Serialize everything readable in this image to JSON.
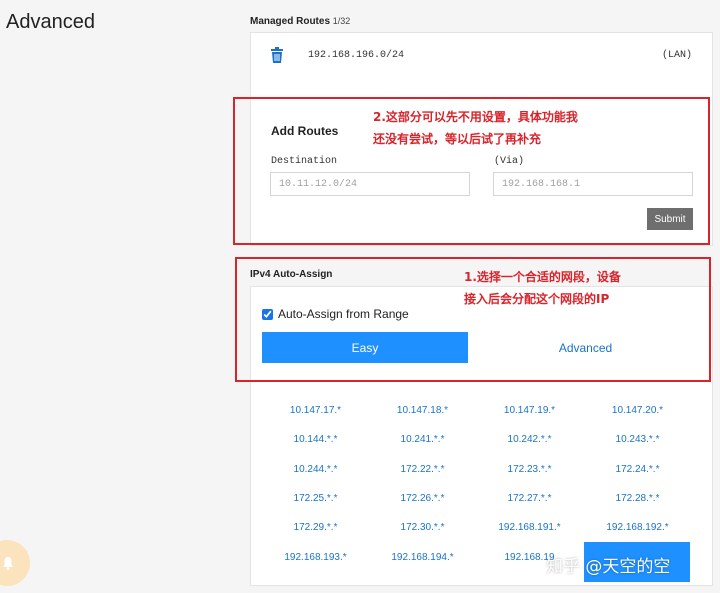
{
  "page": {
    "title": "Advanced"
  },
  "managed_routes": {
    "label": "Managed Routes",
    "count": "1/32",
    "routes": [
      {
        "address": "192.168.196.0/24",
        "tag": "(LAN)"
      }
    ]
  },
  "add_routes": {
    "title": "Add Routes",
    "destination_label": "Destination",
    "destination_placeholder": "10.11.12.0/24",
    "via_label": "(Via)",
    "via_placeholder": "192.168.168.1",
    "submit_label": "Submit"
  },
  "ipv4_auto_assign": {
    "label": "IPv4 Auto-Assign",
    "checkbox_label": "Auto-Assign from Range",
    "checked": true,
    "tabs": [
      {
        "label": "Easy",
        "active": true
      },
      {
        "label": "Advanced",
        "active": false
      }
    ],
    "ranges": [
      [
        "10.147.17.*",
        "10.147.18.*",
        "10.147.19.*",
        "10.147.20.*"
      ],
      [
        "10.144.*.*",
        "10.241.*.*",
        "10.242.*.*",
        "10.243.*.*"
      ],
      [
        "10.244.*.*",
        "172.22.*.*",
        "172.23.*.*",
        "172.24.*.*"
      ],
      [
        "172.25.*.*",
        "172.26.*.*",
        "172.27.*.*",
        "172.28.*.*"
      ],
      [
        "172.29.*.*",
        "172.30.*.*",
        "192.168.191.*",
        "192.168.192.*"
      ],
      [
        "192.168.193.*",
        "192.168.194.*",
        "192.168.19",
        ""
      ]
    ]
  },
  "annotations": {
    "note_1_line1": "1.选择一个合适的网段，设备",
    "note_1_line2": "接入后会分配这个网段的IP",
    "note_2_line1": "2.这部分可以先不用设置，具体功能我",
    "note_2_line2": "还没有尝试，等以后试了再补充",
    "color": "#d9242b"
  },
  "watermark": "知乎 @天空的空",
  "colors": {
    "accent": "#1e90ff",
    "link": "#1a73c8",
    "submit": "#6e6e6e"
  }
}
